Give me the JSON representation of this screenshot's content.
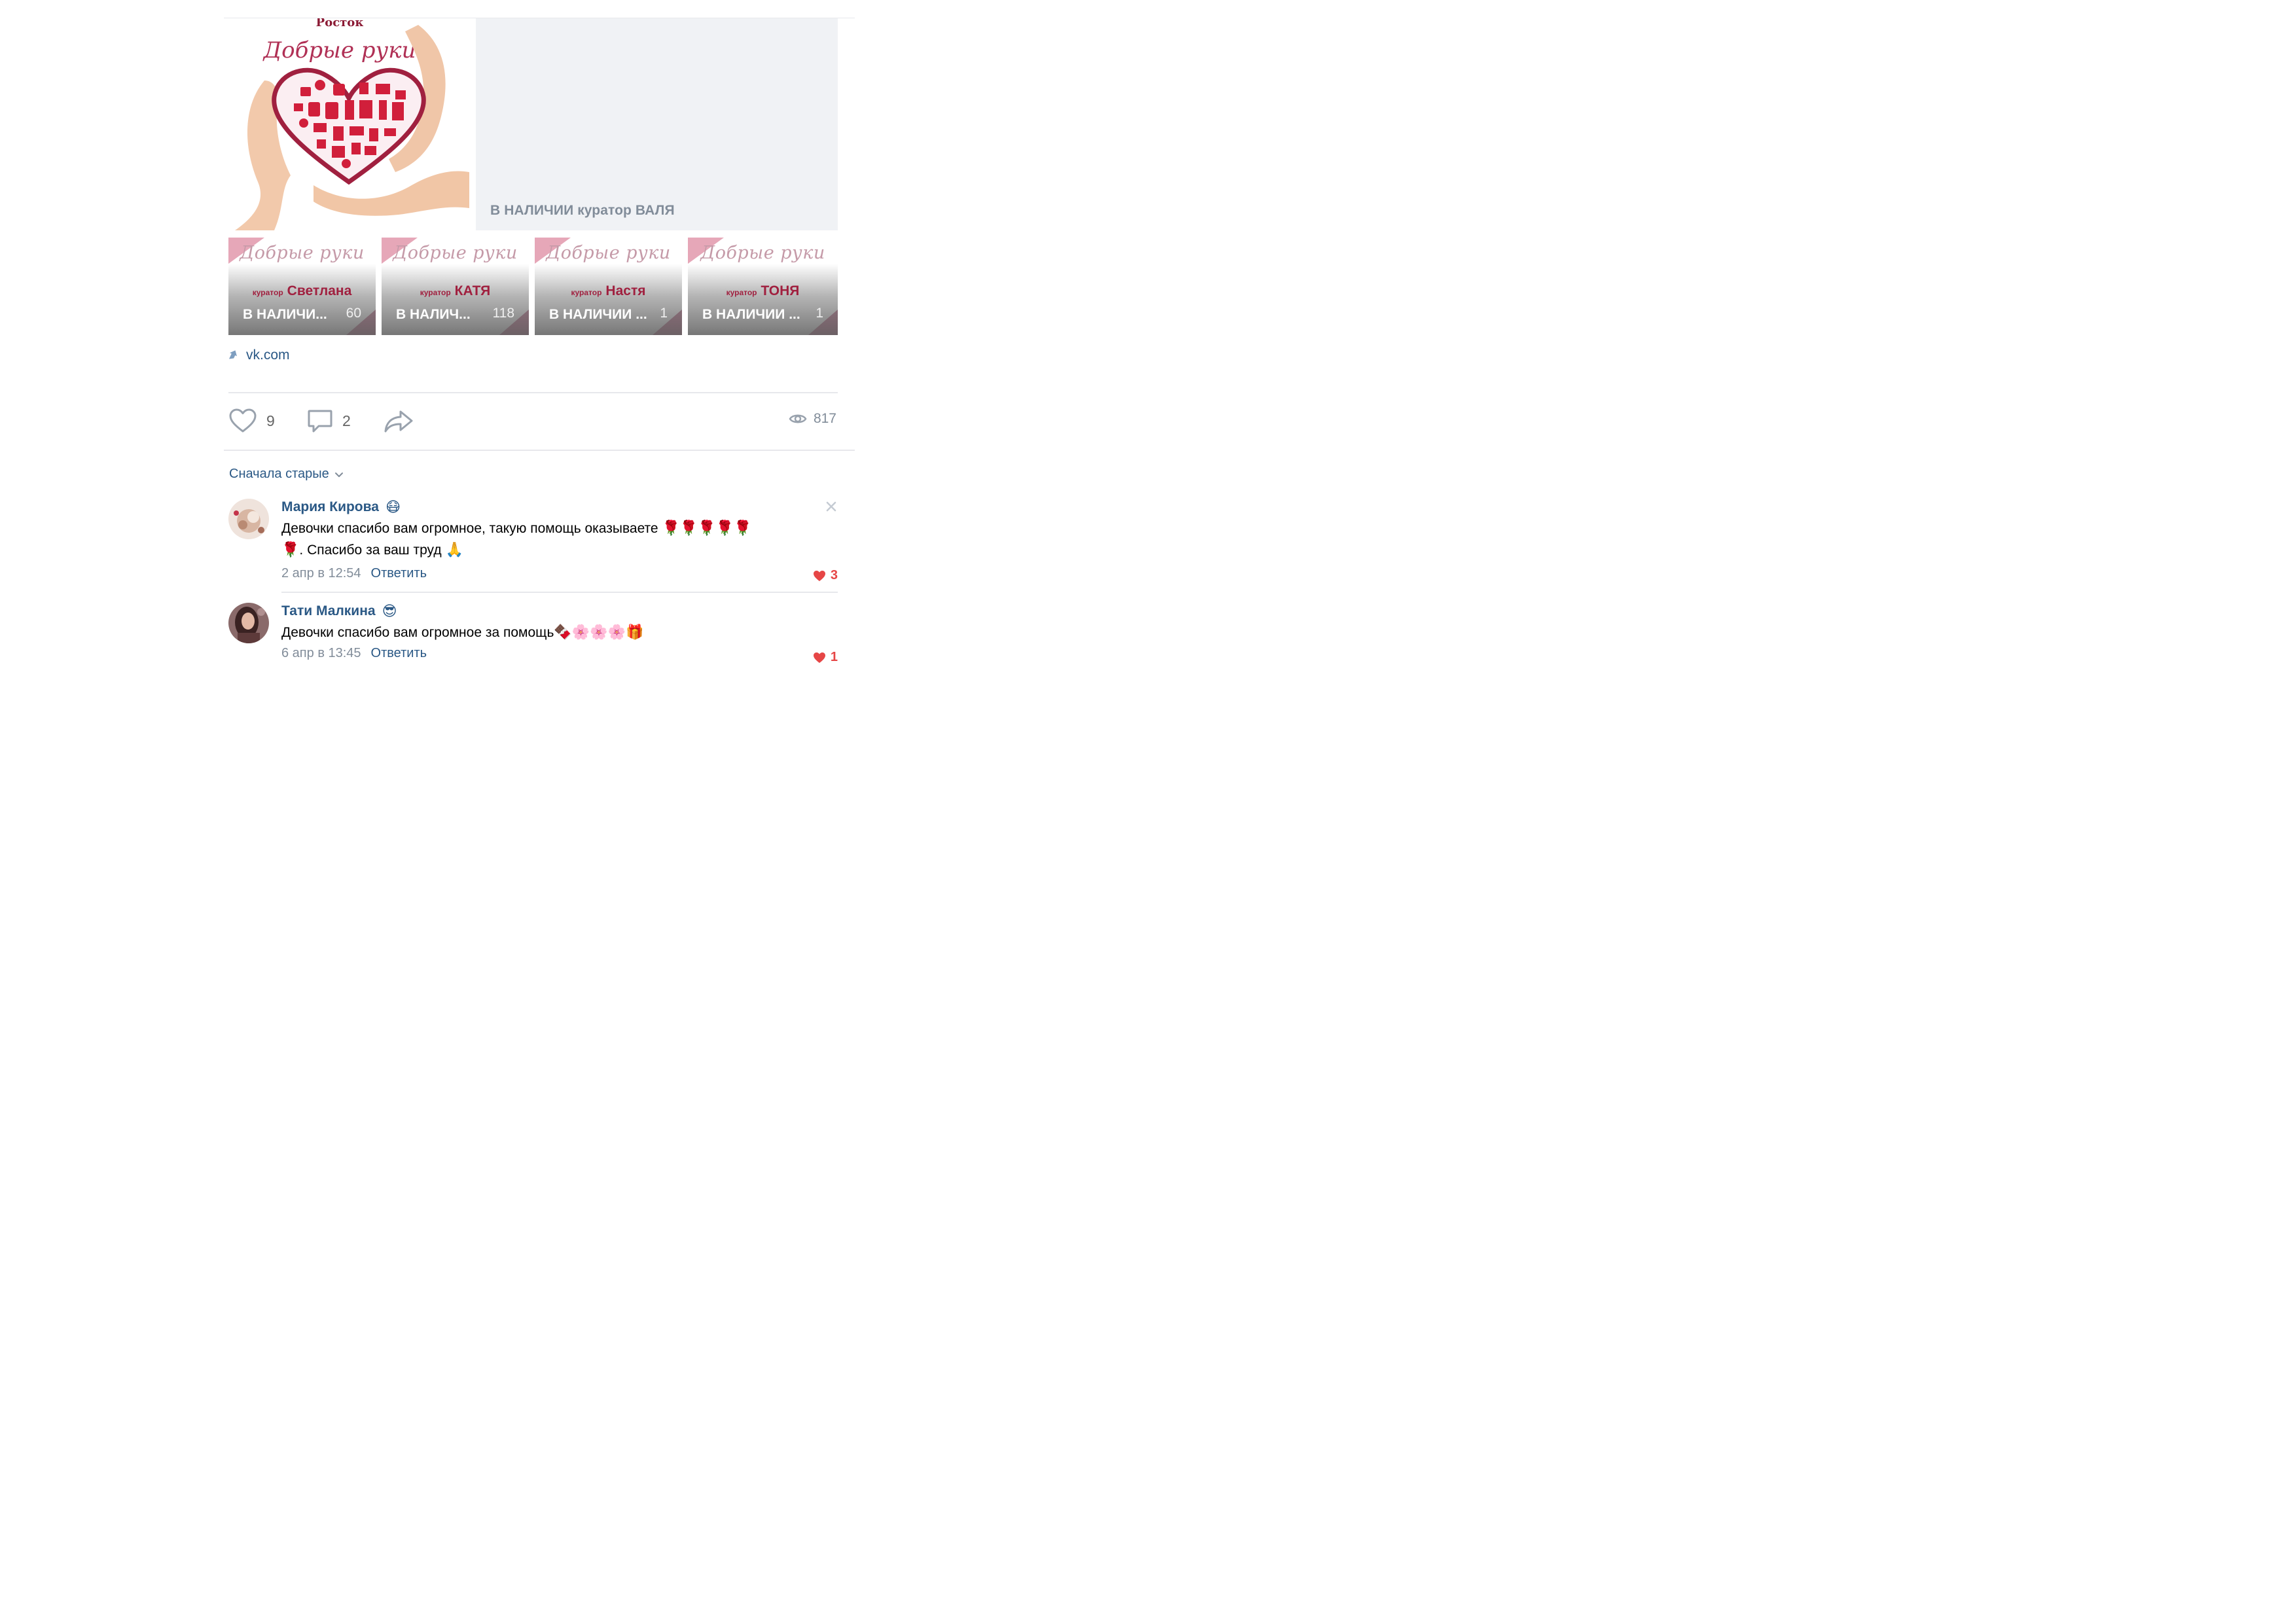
{
  "post": {
    "main_photo": {
      "alt": "Росток Добрые руки",
      "logo_text": "Росток",
      "script_text": "Добрые руки"
    },
    "album": {
      "title": "В НАЛИЧИИ куратор ВАЛЯ"
    },
    "thumbs": [
      {
        "script_text": "Добрые руки",
        "curator_small": "куратор",
        "curator_name": "Светлана",
        "caption": "В НАЛИЧИ...",
        "count": "60"
      },
      {
        "script_text": "Добрые руки",
        "curator_small": "куратор",
        "curator_name": "КАТЯ",
        "caption": "В НАЛИЧ...",
        "count": "118"
      },
      {
        "script_text": "Добрые руки",
        "curator_small": "куратор",
        "curator_name": "Настя",
        "caption": "В НАЛИЧИИ ...",
        "count": "1"
      },
      {
        "script_text": "Добрые руки",
        "curator_small": "куратор",
        "curator_name": "ТОНЯ",
        "caption": "В НАЛИЧИИ ...",
        "count": "1"
      }
    ],
    "link": {
      "text": "vk.com",
      "icon": "external-link-icon"
    },
    "actions": {
      "likes": "9",
      "comments": "2",
      "share_icon": "share-icon",
      "views": "817"
    }
  },
  "comments_section": {
    "sort_label": "Сначала старые",
    "items": [
      {
        "author": "Мария Кирова",
        "author_emoji": "😷",
        "text_line1": "Девочки спасибо вам огромное, такую помощь оказываете",
        "text_line1_emoji": "🌹🌹🌹🌹🌹",
        "text_line2_emoji_start": "🌹",
        "text_line2": ". Спасибо за ваш труд",
        "text_line2_emoji_end": "🙏",
        "date": "2 апр в 12:54",
        "reply_label": "Ответить",
        "likes": "3"
      },
      {
        "author": "Тати Малкина",
        "author_emoji": "😎",
        "text_line1": "Девочки спасибо вам огромное за помощь",
        "text_line1_emoji": "🍫🌸🌸🌸🎁",
        "date": "6 апр в 13:45",
        "reply_label": "Ответить",
        "likes": "1"
      }
    ]
  },
  "colors": {
    "link": "#2a5885",
    "muted": "#818c99",
    "like_red": "#e64646",
    "divider": "#e7e8ec",
    "album_bg": "#f0f2f5",
    "brand_crimson": "#a0203f"
  }
}
